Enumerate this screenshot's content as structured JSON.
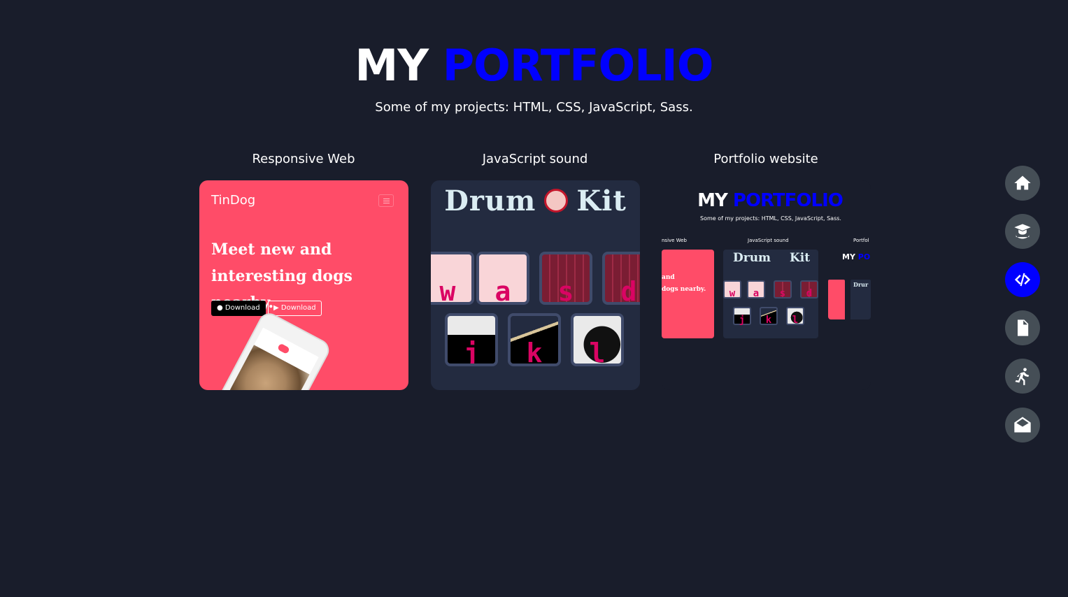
{
  "header": {
    "title_part1": "MY",
    "title_part2": "PORTFOLIO",
    "subtitle": "Some of my projects: HTML, CSS, JavaScript, Sass."
  },
  "projects": [
    {
      "title": "Responsive Web",
      "preview": {
        "brand": "TinDog",
        "headline": "Meet new and interesting dogs nearby.",
        "button1": "Download",
        "button2": "Download"
      }
    },
    {
      "title": "JavaScript sound",
      "preview": {
        "heading_left": "Drum",
        "heading_right": "Kit",
        "keys": [
          "w",
          "a",
          "s",
          "d",
          "j",
          "k",
          "l"
        ]
      }
    },
    {
      "title": "Portfolio website",
      "preview": {
        "title_part1": "MY",
        "title_part2": "PORTFOLIO",
        "subtitle": "Some of my projects: HTML, CSS, JavaScript, Sass.",
        "label1": "nsive Web",
        "label2": "JavaScript sound",
        "label3": "Portfol",
        "tindog_text1": "and",
        "tindog_text2": "dogs nearby.",
        "drum_heading_left": "Drum",
        "drum_heading_right": "Kit",
        "keys": [
          "w",
          "a",
          "s",
          "d",
          "j",
          "k",
          "l"
        ],
        "nested_title_part1": "MY",
        "nested_title_part2": "PO",
        "nested_drum": "Drur"
      }
    }
  ],
  "nav": [
    {
      "icon": "home-icon"
    },
    {
      "icon": "graduate-icon"
    },
    {
      "icon": "code-icon",
      "active": true
    },
    {
      "icon": "document-icon"
    },
    {
      "icon": "running-icon"
    },
    {
      "icon": "envelope-open-icon"
    }
  ],
  "colors": {
    "background": "#191d2b",
    "accent": "#0000ff",
    "nav_button": "#454e56",
    "tindog": "#ff4c68",
    "drumkit_bg": "#232b40",
    "drumkit_key": "#da0463"
  }
}
